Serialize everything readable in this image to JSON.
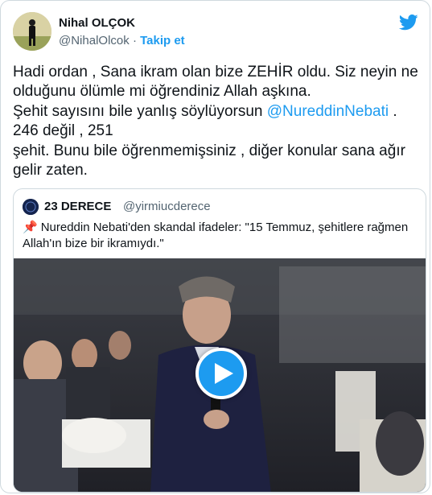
{
  "author": {
    "name": "Nihal OLÇOK",
    "handle": "@NihalOlcok",
    "separator": "·",
    "follow_label": "Takip et"
  },
  "tweet": {
    "text_1": "Hadi ordan , Sana ikram olan bize ZEHİR oldu. Siz neyin ne olduğunu ölümle mi öğrendiniz Allah aşkına.\nŞehit sayısını bile yanlış söylüyorsun ",
    "mention": "@NureddinNebati",
    "text_2": " .\n246 değil , 251\nşehit. Bunu bile öğrenmemişsiniz , diğer konular sana ağır gelir zaten."
  },
  "quoted": {
    "name": "23 DERECE",
    "handle": "@yirmiucderece",
    "pin_glyph": "📌",
    "text": "Nureddin Nebati'den skandal ifadeler: \"15 Temmuz, şehitlere rağmen Allah'ın bize bir ikramıydı.\""
  },
  "icons": {
    "brand": "twitter-bird-icon",
    "play": "play-icon"
  },
  "colors": {
    "accent": "#1d9bf0",
    "text": "#0f1419",
    "secondary": "#536471",
    "border": "#cfd9de"
  }
}
